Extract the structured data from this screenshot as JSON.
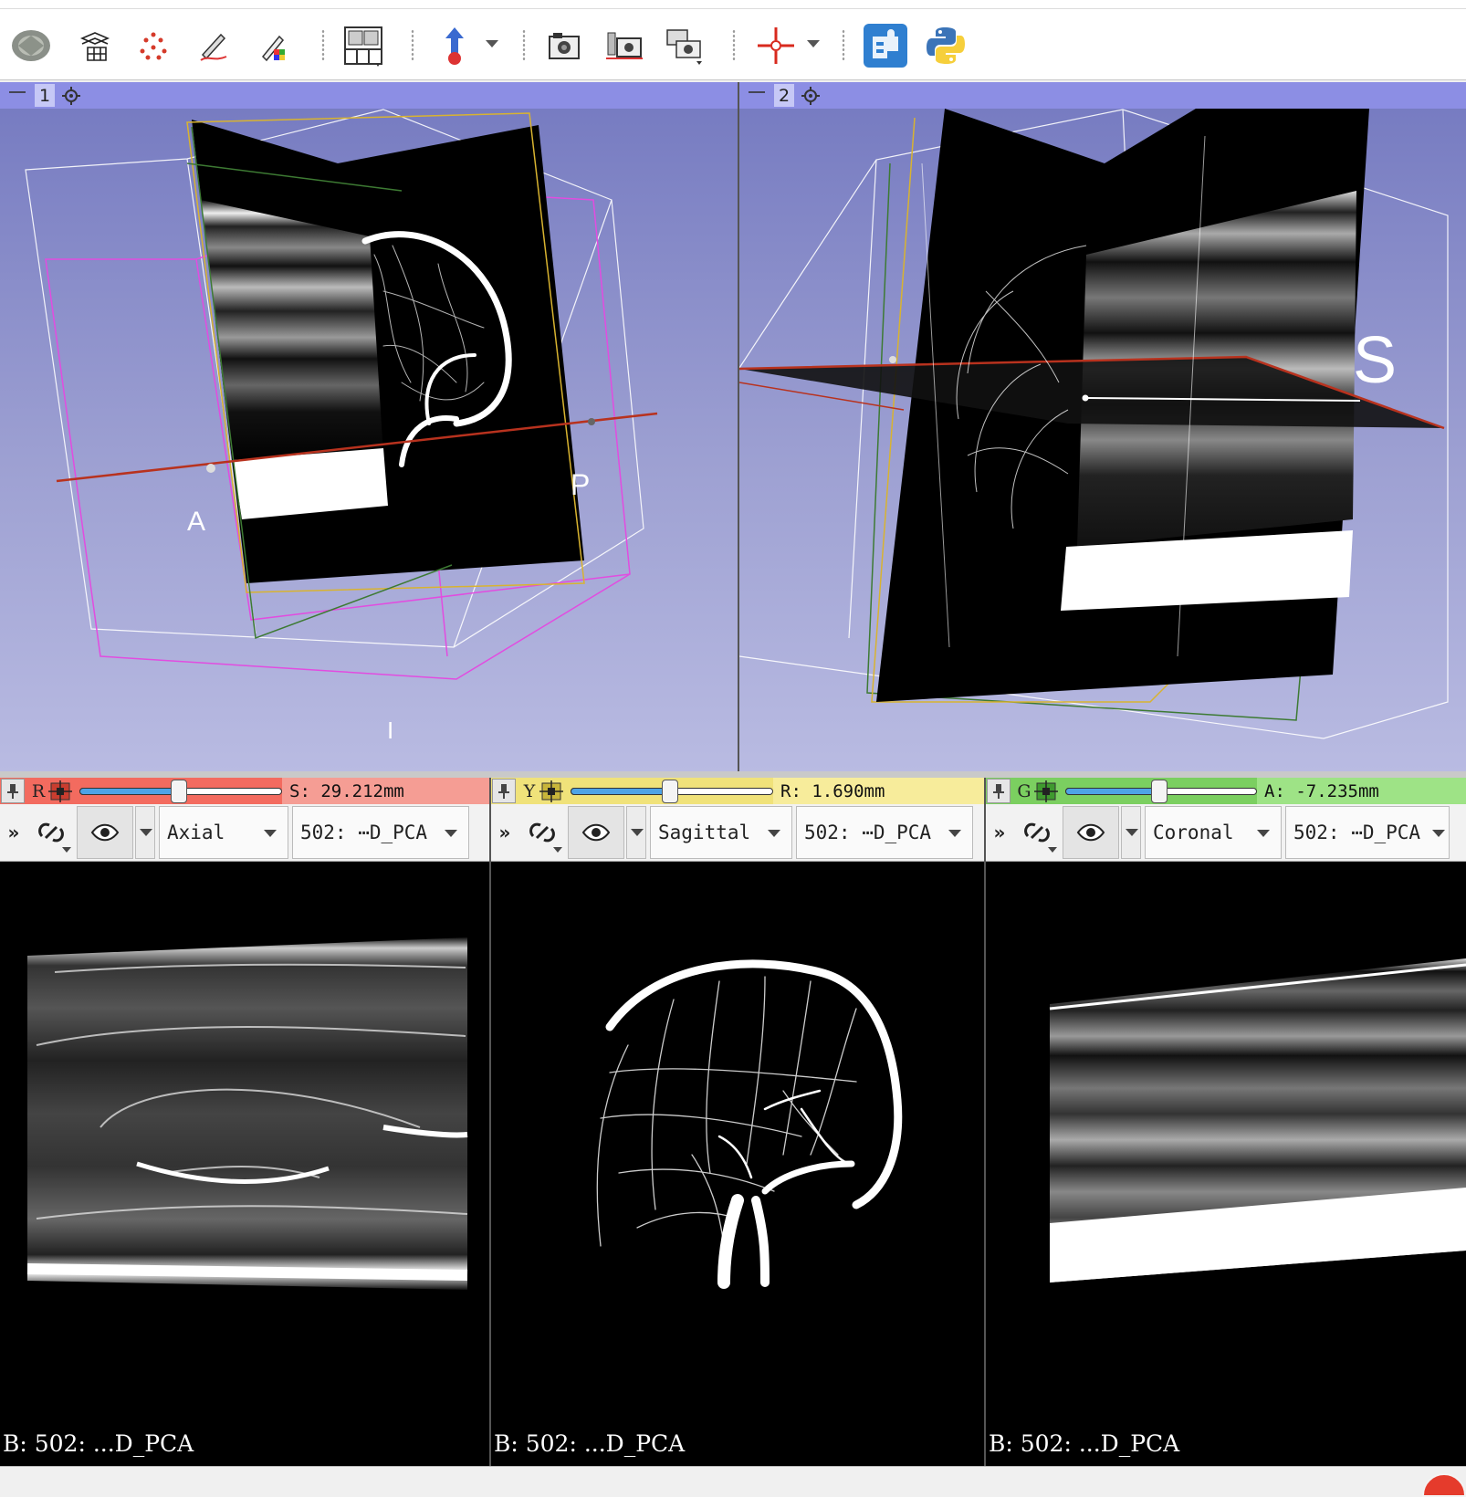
{
  "toolbar": {
    "buttons": [
      "volume-rendering-icon",
      "grid-icon",
      "markups-icon",
      "draw-icon",
      "editor-icon",
      "layout-icon",
      "mouse-mode-icon",
      "capture-icon",
      "scene-view-icon",
      "screenshot-icon",
      "crosshair-icon",
      "extensions-icon",
      "python-icon"
    ]
  },
  "view3d_1": {
    "number": "1",
    "labels": {
      "a": "A",
      "p": "P",
      "i": "I"
    }
  },
  "view3d_2": {
    "number": "2",
    "labels": {
      "s": "S"
    }
  },
  "slices": [
    {
      "letter": "R",
      "color": "#f36b5f",
      "offset": "S: 29.212mm",
      "orientation": "Axial",
      "volume": "502: ⋯D_PCA",
      "label": "B: 502: ...D_PCA",
      "slider": 0.49
    },
    {
      "letter": "Y",
      "color": "#f0e27a",
      "offset": "R: 1.690mm",
      "orientation": "Sagittal",
      "volume": "502: ⋯D_PCA",
      "label": "B: 502: ...D_PCA",
      "slider": 0.49
    },
    {
      "letter": "G",
      "color": "#7bcf60",
      "offset": "A: -7.235mm",
      "orientation": "Coronal",
      "volume": "502: ⋯D_PCA",
      "label": "B: 502: ...D_PCA",
      "slider": 0.5
    }
  ],
  "more_symbol": "»"
}
